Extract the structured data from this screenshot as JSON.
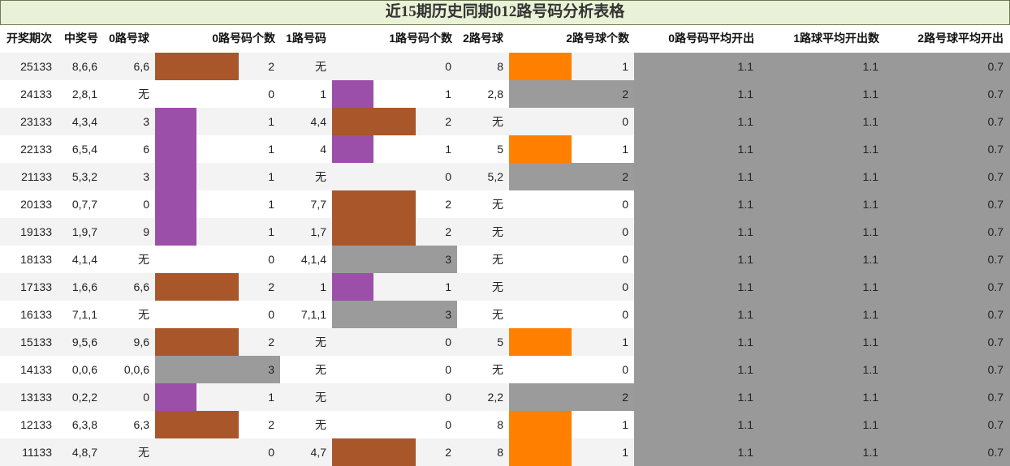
{
  "title": "近15期历史同期012路号码分析表格",
  "headers": [
    "开奖期次",
    "中奖号",
    "0路号球",
    "0路号码个数",
    "1路号码",
    "1路号码个数",
    "2路号球",
    "2路号球个数",
    "0路号码平均开出",
    "1路球平均开出数",
    "2路号球平均开出"
  ],
  "colors": {
    "one": "#9b4fa8",
    "two": "#a8562a",
    "three": "#9b9b9b",
    "orange": "#ff8000",
    "stripe": "#f3f3f3",
    "title_bg": "#e9f2d6"
  },
  "chart_data": {
    "type": "table",
    "rows": [
      {
        "period": "25133",
        "number": "8,6,6",
        "r0": "6,6",
        "c0": 2,
        "r1": "无",
        "c1": 0,
        "r2": "8",
        "c2": 1,
        "a0": "1.1",
        "a1": "1.1",
        "a2": "0.7"
      },
      {
        "period": "24133",
        "number": "2,8,1",
        "r0": "无",
        "c0": 0,
        "r1": "1",
        "c1": 1,
        "r2": "2,8",
        "c2": 2,
        "a0": "1.1",
        "a1": "1.1",
        "a2": "0.7"
      },
      {
        "period": "23133",
        "number": "4,3,4",
        "r0": "3",
        "c0": 1,
        "r1": "4,4",
        "c1": 2,
        "r2": "无",
        "c2": 0,
        "a0": "1.1",
        "a1": "1.1",
        "a2": "0.7"
      },
      {
        "period": "22133",
        "number": "6,5,4",
        "r0": "6",
        "c0": 1,
        "r1": "4",
        "c1": 1,
        "r2": "5",
        "c2": 1,
        "a0": "1.1",
        "a1": "1.1",
        "a2": "0.7"
      },
      {
        "period": "21133",
        "number": "5,3,2",
        "r0": "3",
        "c0": 1,
        "r1": "无",
        "c1": 0,
        "r2": "5,2",
        "c2": 2,
        "a0": "1.1",
        "a1": "1.1",
        "a2": "0.7"
      },
      {
        "period": "20133",
        "number": "0,7,7",
        "r0": "0",
        "c0": 1,
        "r1": "7,7",
        "c1": 2,
        "r2": "无",
        "c2": 0,
        "a0": "1.1",
        "a1": "1.1",
        "a2": "0.7"
      },
      {
        "period": "19133",
        "number": "1,9,7",
        "r0": "9",
        "c0": 1,
        "r1": "1,7",
        "c1": 2,
        "r2": "无",
        "c2": 0,
        "a0": "1.1",
        "a1": "1.1",
        "a2": "0.7"
      },
      {
        "period": "18133",
        "number": "4,1,4",
        "r0": "无",
        "c0": 0,
        "r1": "4,1,4",
        "c1": 3,
        "r2": "无",
        "c2": 0,
        "a0": "1.1",
        "a1": "1.1",
        "a2": "0.7"
      },
      {
        "period": "17133",
        "number": "1,6,6",
        "r0": "6,6",
        "c0": 2,
        "r1": "1",
        "c1": 1,
        "r2": "无",
        "c2": 0,
        "a0": "1.1",
        "a1": "1.1",
        "a2": "0.7"
      },
      {
        "period": "16133",
        "number": "7,1,1",
        "r0": "无",
        "c0": 0,
        "r1": "7,1,1",
        "c1": 3,
        "r2": "无",
        "c2": 0,
        "a0": "1.1",
        "a1": "1.1",
        "a2": "0.7"
      },
      {
        "period": "15133",
        "number": "9,5,6",
        "r0": "9,6",
        "c0": 2,
        "r1": "无",
        "c1": 0,
        "r2": "5",
        "c2": 1,
        "a0": "1.1",
        "a1": "1.1",
        "a2": "0.7"
      },
      {
        "period": "14133",
        "number": "0,0,6",
        "r0": "0,0,6",
        "c0": 3,
        "r1": "无",
        "c1": 0,
        "r2": "无",
        "c2": 0,
        "a0": "1.1",
        "a1": "1.1",
        "a2": "0.7"
      },
      {
        "period": "13133",
        "number": "0,2,2",
        "r0": "0",
        "c0": 1,
        "r1": "无",
        "c1": 0,
        "r2": "2,2",
        "c2": 2,
        "a0": "1.1",
        "a1": "1.1",
        "a2": "0.7"
      },
      {
        "period": "12133",
        "number": "6,3,8",
        "r0": "6,3",
        "c0": 2,
        "r1": "无",
        "c1": 0,
        "r2": "8",
        "c2": 1,
        "a0": "1.1",
        "a1": "1.1",
        "a2": "0.7"
      },
      {
        "period": "11133",
        "number": "4,8,7",
        "r0": "无",
        "c0": 0,
        "r1": "4,7",
        "c1": 2,
        "r2": "8",
        "c2": 1,
        "a0": "1.1",
        "a1": "1.1",
        "a2": "0.7"
      }
    ]
  }
}
